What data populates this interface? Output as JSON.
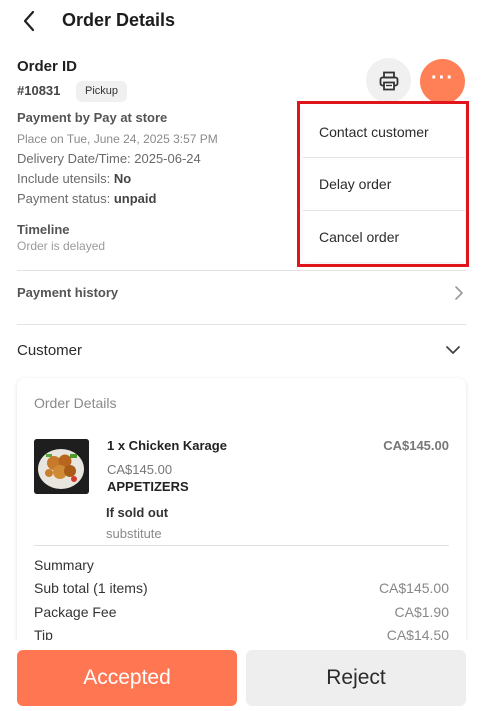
{
  "header": {
    "title": "Order Details"
  },
  "order": {
    "id_title": "Order ID",
    "number": "#10831",
    "type": "Pickup",
    "payment_method": "Payment by Pay at store",
    "placed_on": "Place on Tue, June 24, 2025 3:57 PM",
    "delivery": "Delivery Date/Time: 2025-06-24",
    "utensils_label": "Include utensils:",
    "utensils_value": "No",
    "payment_status_label": "Payment status:",
    "payment_status_value": "unpaid"
  },
  "timeline": {
    "title": "Timeline",
    "status": "Order is delayed"
  },
  "sections": {
    "payment_history": "Payment history",
    "customer": "Customer"
  },
  "dropdown": {
    "items": [
      {
        "label": "Contact customer"
      },
      {
        "label": "Delay order"
      },
      {
        "label": "Cancel order"
      }
    ]
  },
  "card": {
    "title": "Order Details",
    "item": {
      "name": "1 x Chicken Karage",
      "total": "CA$145.00",
      "unit_price": "CA$145.00",
      "category": "APPETIZERS",
      "sold_out_label": "If sold out",
      "sold_out_value": "substitute"
    },
    "summary": {
      "title": "Summary",
      "rows": [
        {
          "label": "Sub total (1 items)",
          "value": "CA$145.00"
        },
        {
          "label": "Package Fee",
          "value": "CA$1.90"
        },
        {
          "label": "Tip",
          "value": "CA$14.50"
        }
      ]
    }
  },
  "footer": {
    "accept_label": "Accepted",
    "reject_label": "Reject"
  },
  "colors": {
    "accent": "#ff7752",
    "highlight": "#e0141b"
  }
}
